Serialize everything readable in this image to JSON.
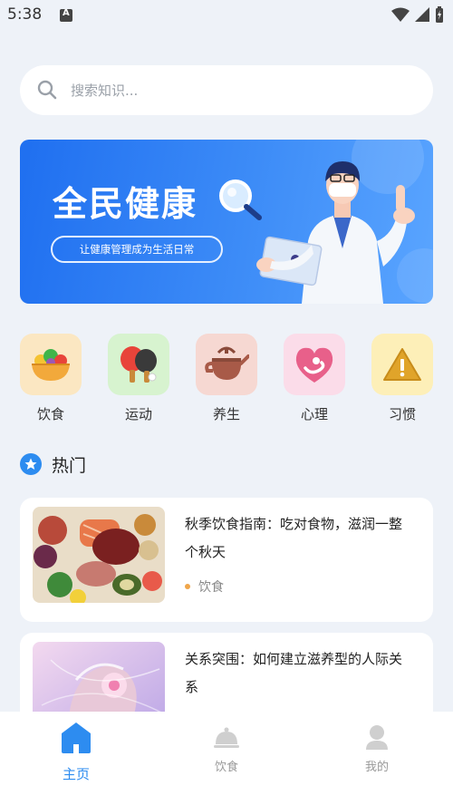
{
  "status_bar": {
    "time": "5:38"
  },
  "search": {
    "placeholder": "搜索知识..."
  },
  "banner": {
    "title": "全民健康",
    "subtitle": "让健康管理成为生活日常"
  },
  "categories": [
    {
      "label": "饮食",
      "icon": "fruit-bowl-icon",
      "bg": "#fbe7c2"
    },
    {
      "label": "运动",
      "icon": "ping-pong-icon",
      "bg": "#d7f3cf"
    },
    {
      "label": "养生",
      "icon": "teapot-icon",
      "bg": "#f6d8d2"
    },
    {
      "label": "心理",
      "icon": "heart-icon",
      "bg": "#fbdce9"
    },
    {
      "label": "习惯",
      "icon": "warning-icon",
      "bg": "#fdefb8"
    }
  ],
  "hot": {
    "title": "热门"
  },
  "articles": [
    {
      "title": "秋季饮食指南：吃对食物，滋润一整个秋天",
      "tag": "饮食"
    },
    {
      "title": "关系突围：如何建立滋养型的人际关系",
      "tag": ""
    }
  ],
  "tabbar": {
    "tabs": [
      {
        "label": "主页"
      },
      {
        "label": "饮食"
      },
      {
        "label": "我的"
      }
    ]
  },
  "colors": {
    "accent": "#2d8cf0",
    "banner": "#2f7ef4",
    "background": "#eef2f8"
  }
}
